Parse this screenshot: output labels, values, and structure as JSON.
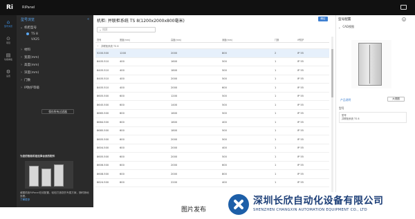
{
  "app": {
    "logo": "Ri",
    "name": "RiPanel"
  },
  "rail": [
    {
      "label": "型号浏览",
      "icon": "home-icon"
    },
    {
      "label": "项目",
      "icon": "pin-icon"
    },
    {
      "label": "功能看板",
      "icon": "board-icon"
    },
    {
      "label": "设置",
      "icon": "gear-icon"
    }
  ],
  "panel": {
    "title": "型号浏览",
    "tree": [
      {
        "label": "机柜型号",
        "level": 0,
        "open": true
      },
      {
        "label": "TS 8",
        "level": 1,
        "selected": true
      },
      {
        "label": "VX25",
        "level": 1
      },
      {
        "label": "材料",
        "level": 0
      },
      {
        "label": "宽度(mm)",
        "level": 0
      },
      {
        "label": "高度(mm)",
        "level": 0
      },
      {
        "label": "深度(mm)",
        "level": 0
      },
      {
        "label": "门数",
        "level": 0
      },
      {
        "label": "IP防护等级",
        "level": 0
      }
    ],
    "load_button": "保存所有过滤器",
    "promo": {
      "title": "为您的智能机柜选择合适的配件",
      "text": "威图机柜RiPanel在线配置，轻松打造您的专属方案，随时随地查看。",
      "link": "了解更多"
    }
  },
  "main": {
    "title": "机柜: 并联柜系统 TS 8(1200x2000x800毫米)",
    "apply_label": "确定",
    "search_placeholder": "搜索",
    "columns": [
      "货号",
      "宽度(mm)",
      "高度(mm)",
      "深度(mm)",
      "门数",
      "IP防护"
    ],
    "group_label": "并联柜系统 TS 8",
    "rows": [
      [
        "5200.500",
        "1200",
        "2000",
        "800",
        "2",
        "IP 55"
      ],
      [
        "8405.510",
        "400",
        "1600",
        "500",
        "1",
        "IP 55"
      ],
      [
        "8405.510",
        "400",
        "1800",
        "500",
        "1",
        "IP 55"
      ],
      [
        "8405.510",
        "400",
        "2000",
        "500",
        "1",
        "IP 55"
      ],
      [
        "8405.510",
        "400",
        "2000",
        "600",
        "1",
        "IP 55"
      ],
      [
        "8605.500",
        "600",
        "1200",
        "500",
        "1",
        "IP 55"
      ],
      [
        "8645.500",
        "600",
        "1400",
        "500",
        "1",
        "IP 55"
      ],
      [
        "8665.500",
        "600",
        "1600",
        "500",
        "1",
        "IP 55"
      ],
      [
        "8684.500",
        "600",
        "1800",
        "400",
        "1",
        "IP 55"
      ],
      [
        "8685.500",
        "600",
        "1800",
        "500",
        "1",
        "IP 55"
      ],
      [
        "8605.500",
        "600",
        "2000",
        "500",
        "1",
        "IP 55"
      ],
      [
        "8604.500",
        "600",
        "2000",
        "400",
        "1",
        "IP 55"
      ],
      [
        "8605.500",
        "600",
        "2000",
        "500",
        "1",
        "IP 55"
      ],
      [
        "8606.500",
        "600",
        "2000",
        "600",
        "1",
        "IP 55"
      ],
      [
        "8608.500",
        "600",
        "2000",
        "800",
        "1",
        "IP 55"
      ],
      [
        "8624.500",
        "600",
        "2200",
        "400",
        "1",
        "IP 55"
      ]
    ],
    "selected_row": 0
  },
  "right": {
    "title": "型号配置",
    "cad_section": "CAD视图",
    "link": "产品说明",
    "button": "大视图",
    "label": "型号",
    "card_line1": "型号",
    "card_line2": "并联柜系统 TS 8"
  },
  "footer": {
    "caption": "图片发布"
  },
  "watermark": {
    "cn": "深圳长欣自动化设备有限公司",
    "en": "SHENZHEN CHANGXIN AUTOMATION EQUIPMENT CO., LTD"
  }
}
